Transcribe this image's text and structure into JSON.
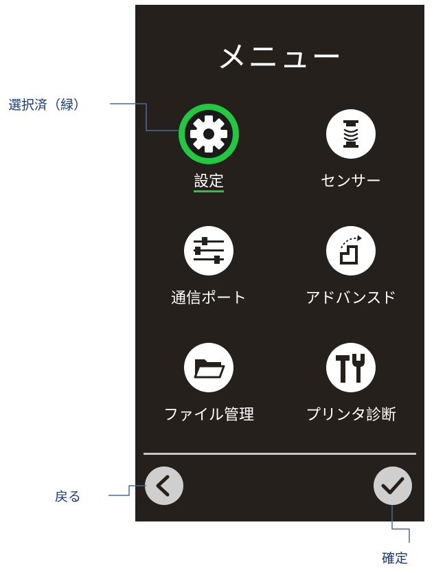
{
  "menu": {
    "title": "メニュー",
    "items": [
      {
        "label": "設定",
        "icon": "gear-icon",
        "selected": true
      },
      {
        "label": "センサー",
        "icon": "sensor-icon",
        "selected": false
      },
      {
        "label": "通信ポート",
        "icon": "sliders-icon",
        "selected": false
      },
      {
        "label": "アドバンスド",
        "icon": "stairs-icon",
        "selected": false
      },
      {
        "label": "ファイル管理",
        "icon": "folder-icon",
        "selected": false
      },
      {
        "label": "プリンタ診断",
        "icon": "tools-icon",
        "selected": false
      }
    ]
  },
  "nav": {
    "back_icon": "chevron-left-icon",
    "confirm_icon": "checkmark-icon"
  },
  "callouts": {
    "selected": "選択済（緑）",
    "back": "戻る",
    "confirm": "確定"
  },
  "colors": {
    "screen_bg": "#26201c",
    "selected_ring": "#22c840",
    "icon_bg": "#ffffff",
    "nav_button_bg": "#cfcfcf",
    "callout_text": "#1a3a7a"
  }
}
